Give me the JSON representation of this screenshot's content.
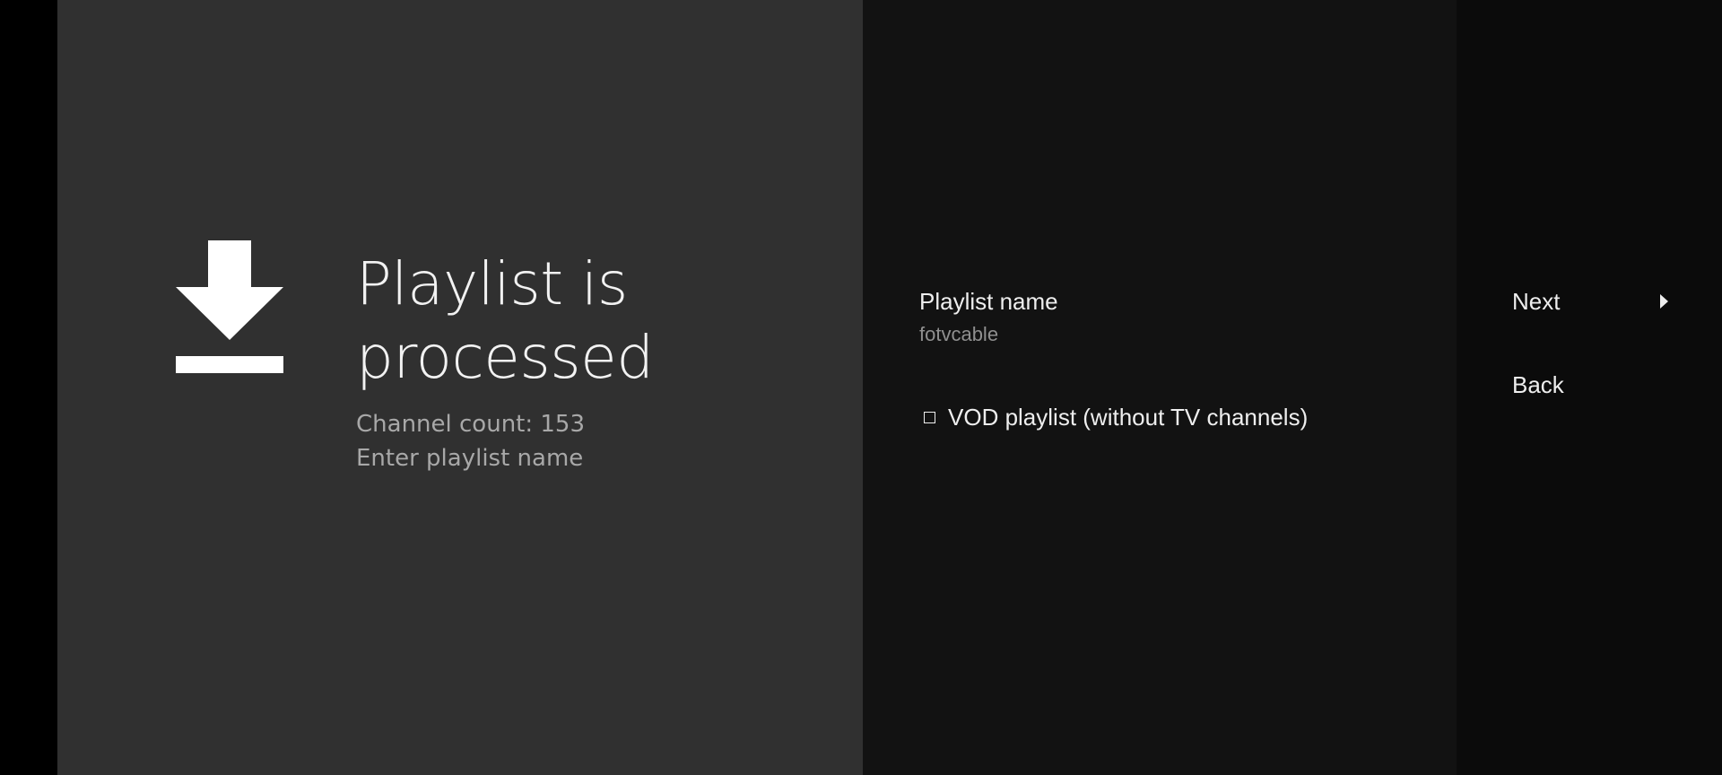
{
  "guidance": {
    "icon": "download-icon",
    "title": "Playlist is processed",
    "description": [
      "Channel count: 153",
      "Enter playlist name"
    ]
  },
  "playlist_name_field": {
    "title": "Playlist name",
    "value": "fotvcable"
  },
  "vod_option": {
    "label": "VOD playlist (without TV channels)",
    "checked": false
  },
  "buttons": {
    "next_label": "Next",
    "back_label": "Back"
  },
  "colors": {
    "left_pane": "#303030",
    "middle_pane": "#121212",
    "right_pane": "#0b0b0b",
    "primary_text": "#eeeeee",
    "secondary_text": "#a8a8a8"
  }
}
